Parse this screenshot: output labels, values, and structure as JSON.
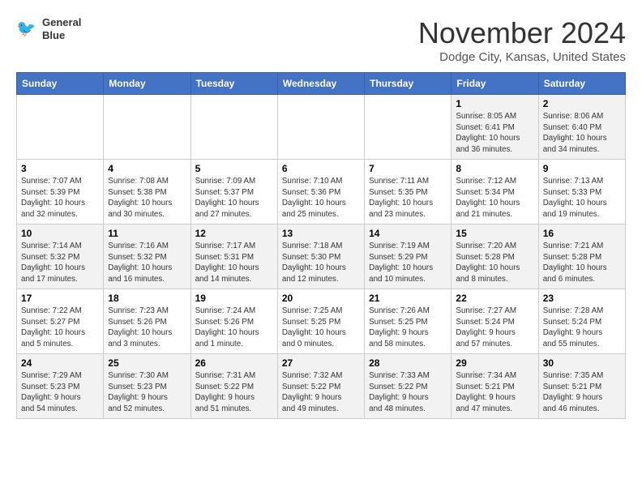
{
  "header": {
    "logo_line1": "General",
    "logo_line2": "Blue",
    "month": "November 2024",
    "location": "Dodge City, Kansas, United States"
  },
  "weekdays": [
    "Sunday",
    "Monday",
    "Tuesday",
    "Wednesday",
    "Thursday",
    "Friday",
    "Saturday"
  ],
  "weeks": [
    [
      {
        "day": "",
        "info": ""
      },
      {
        "day": "",
        "info": ""
      },
      {
        "day": "",
        "info": ""
      },
      {
        "day": "",
        "info": ""
      },
      {
        "day": "",
        "info": ""
      },
      {
        "day": "1",
        "info": "Sunrise: 8:05 AM\nSunset: 6:41 PM\nDaylight: 10 hours\nand 36 minutes."
      },
      {
        "day": "2",
        "info": "Sunrise: 8:06 AM\nSunset: 6:40 PM\nDaylight: 10 hours\nand 34 minutes."
      }
    ],
    [
      {
        "day": "3",
        "info": "Sunrise: 7:07 AM\nSunset: 5:39 PM\nDaylight: 10 hours\nand 32 minutes."
      },
      {
        "day": "4",
        "info": "Sunrise: 7:08 AM\nSunset: 5:38 PM\nDaylight: 10 hours\nand 30 minutes."
      },
      {
        "day": "5",
        "info": "Sunrise: 7:09 AM\nSunset: 5:37 PM\nDaylight: 10 hours\nand 27 minutes."
      },
      {
        "day": "6",
        "info": "Sunrise: 7:10 AM\nSunset: 5:36 PM\nDaylight: 10 hours\nand 25 minutes."
      },
      {
        "day": "7",
        "info": "Sunrise: 7:11 AM\nSunset: 5:35 PM\nDaylight: 10 hours\nand 23 minutes."
      },
      {
        "day": "8",
        "info": "Sunrise: 7:12 AM\nSunset: 5:34 PM\nDaylight: 10 hours\nand 21 minutes."
      },
      {
        "day": "9",
        "info": "Sunrise: 7:13 AM\nSunset: 5:33 PM\nDaylight: 10 hours\nand 19 minutes."
      }
    ],
    [
      {
        "day": "10",
        "info": "Sunrise: 7:14 AM\nSunset: 5:32 PM\nDaylight: 10 hours\nand 17 minutes."
      },
      {
        "day": "11",
        "info": "Sunrise: 7:16 AM\nSunset: 5:32 PM\nDaylight: 10 hours\nand 16 minutes."
      },
      {
        "day": "12",
        "info": "Sunrise: 7:17 AM\nSunset: 5:31 PM\nDaylight: 10 hours\nand 14 minutes."
      },
      {
        "day": "13",
        "info": "Sunrise: 7:18 AM\nSunset: 5:30 PM\nDaylight: 10 hours\nand 12 minutes."
      },
      {
        "day": "14",
        "info": "Sunrise: 7:19 AM\nSunset: 5:29 PM\nDaylight: 10 hours\nand 10 minutes."
      },
      {
        "day": "15",
        "info": "Sunrise: 7:20 AM\nSunset: 5:28 PM\nDaylight: 10 hours\nand 8 minutes."
      },
      {
        "day": "16",
        "info": "Sunrise: 7:21 AM\nSunset: 5:28 PM\nDaylight: 10 hours\nand 6 minutes."
      }
    ],
    [
      {
        "day": "17",
        "info": "Sunrise: 7:22 AM\nSunset: 5:27 PM\nDaylight: 10 hours\nand 5 minutes."
      },
      {
        "day": "18",
        "info": "Sunrise: 7:23 AM\nSunset: 5:26 PM\nDaylight: 10 hours\nand 3 minutes."
      },
      {
        "day": "19",
        "info": "Sunrise: 7:24 AM\nSunset: 5:26 PM\nDaylight: 10 hours\nand 1 minute."
      },
      {
        "day": "20",
        "info": "Sunrise: 7:25 AM\nSunset: 5:25 PM\nDaylight: 10 hours\nand 0 minutes."
      },
      {
        "day": "21",
        "info": "Sunrise: 7:26 AM\nSunset: 5:25 PM\nDaylight: 9 hours\nand 58 minutes."
      },
      {
        "day": "22",
        "info": "Sunrise: 7:27 AM\nSunset: 5:24 PM\nDaylight: 9 hours\nand 57 minutes."
      },
      {
        "day": "23",
        "info": "Sunrise: 7:28 AM\nSunset: 5:24 PM\nDaylight: 9 hours\nand 55 minutes."
      }
    ],
    [
      {
        "day": "24",
        "info": "Sunrise: 7:29 AM\nSunset: 5:23 PM\nDaylight: 9 hours\nand 54 minutes."
      },
      {
        "day": "25",
        "info": "Sunrise: 7:30 AM\nSunset: 5:23 PM\nDaylight: 9 hours\nand 52 minutes."
      },
      {
        "day": "26",
        "info": "Sunrise: 7:31 AM\nSunset: 5:22 PM\nDaylight: 9 hours\nand 51 minutes."
      },
      {
        "day": "27",
        "info": "Sunrise: 7:32 AM\nSunset: 5:22 PM\nDaylight: 9 hours\nand 49 minutes."
      },
      {
        "day": "28",
        "info": "Sunrise: 7:33 AM\nSunset: 5:22 PM\nDaylight: 9 hours\nand 48 minutes."
      },
      {
        "day": "29",
        "info": "Sunrise: 7:34 AM\nSunset: 5:21 PM\nDaylight: 9 hours\nand 47 minutes."
      },
      {
        "day": "30",
        "info": "Sunrise: 7:35 AM\nSunset: 5:21 PM\nDaylight: 9 hours\nand 46 minutes."
      }
    ]
  ]
}
